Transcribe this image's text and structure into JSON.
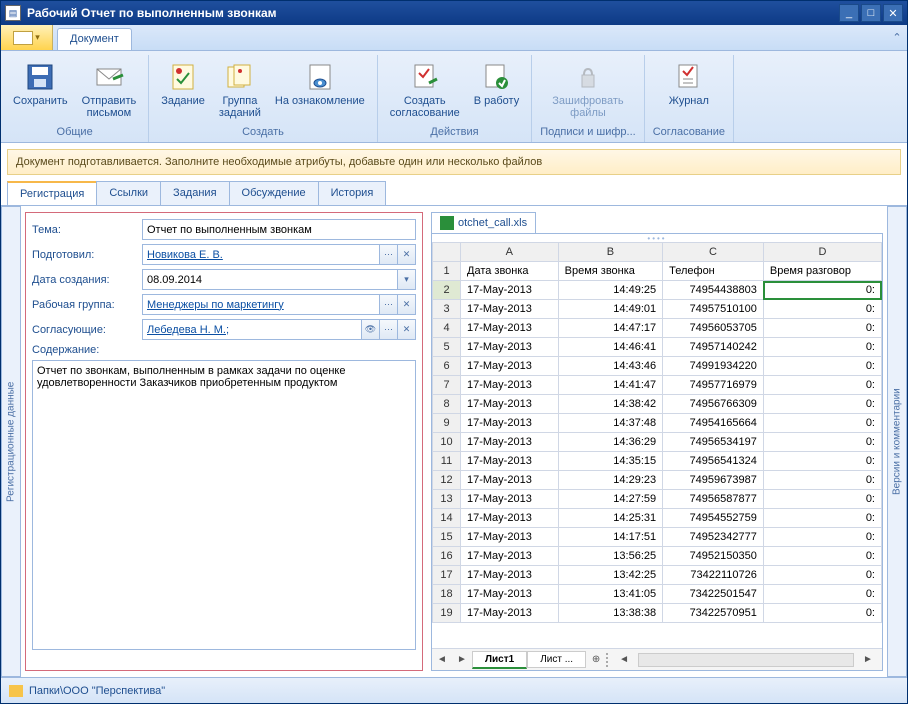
{
  "window_title": "Рабочий Отчет по выполненным звонкам",
  "ribbon": {
    "tab_document": "Документ",
    "groups": {
      "common": {
        "title": "Общие",
        "save": "Сохранить",
        "send": "Отправить\nписьмом"
      },
      "create": {
        "title": "Создать",
        "task": "Задание",
        "task_group": "Группа\nзаданий",
        "review": "На ознакомление"
      },
      "actions": {
        "title": "Действия",
        "approval": "Создать\nсогласование",
        "work": "В работу"
      },
      "sign": {
        "title": "Подписи и шифр...",
        "encrypt": "Зашифровать\nфайлы"
      },
      "approval": {
        "title": "Согласование",
        "journal": "Журнал"
      }
    }
  },
  "notice": "Документ подготавливается. Заполните необходимые атрибуты, добавьте один или несколько файлов",
  "tabs": {
    "registration": "Регистрация",
    "links": "Ссылки",
    "tasks": "Задания",
    "discussion": "Обсуждение",
    "history": "История"
  },
  "side": {
    "reg_data": "Регистрационные данные",
    "versions": "Версии и комментарии"
  },
  "form": {
    "subject_label": "Тема:",
    "subject": "Отчет по выполненным звонкам",
    "prepared_label": "Подготовил:",
    "prepared": "Новикова Е. В.",
    "date_label": "Дата создания:",
    "date": "08.09.2014",
    "group_label": "Рабочая группа:",
    "group": "Менеджеры по маркетингу",
    "approvers_label": "Согласующие:",
    "approvers": "Лебедева Н. М.;",
    "content_label": "Содержание:",
    "content": "Отчет по звонкам, выполненным в рамках задачи по оценке удовлетворенности Заказчиков приобретенным продуктом"
  },
  "file": {
    "name": "otchet_call.xls"
  },
  "sheet": {
    "cols": [
      "A",
      "B",
      "C",
      "D"
    ],
    "headers": [
      "Дата звонка",
      "Время звонка",
      "Телефон",
      "Время разговор"
    ],
    "rows": [
      [
        "17-May-2013",
        "14:49:25",
        "74954438803",
        "0:"
      ],
      [
        "17-May-2013",
        "14:49:01",
        "74957510100",
        "0:"
      ],
      [
        "17-May-2013",
        "14:47:17",
        "74956053705",
        "0:"
      ],
      [
        "17-May-2013",
        "14:46:41",
        "74957140242",
        "0:"
      ],
      [
        "17-May-2013",
        "14:43:46",
        "74991934220",
        "0:"
      ],
      [
        "17-May-2013",
        "14:41:47",
        "74957716979",
        "0:"
      ],
      [
        "17-May-2013",
        "14:38:42",
        "74956766309",
        "0:"
      ],
      [
        "17-May-2013",
        "14:37:48",
        "74954165664",
        "0:"
      ],
      [
        "17-May-2013",
        "14:36:29",
        "74956534197",
        "0:"
      ],
      [
        "17-May-2013",
        "14:35:15",
        "74956541324",
        "0:"
      ],
      [
        "17-May-2013",
        "14:29:23",
        "74959673987",
        "0:"
      ],
      [
        "17-May-2013",
        "14:27:59",
        "74956587877",
        "0:"
      ],
      [
        "17-May-2013",
        "14:25:31",
        "74954552759",
        "0:"
      ],
      [
        "17-May-2013",
        "14:17:51",
        "74952342777",
        "0:"
      ],
      [
        "17-May-2013",
        "13:56:25",
        "74952150350",
        "0:"
      ],
      [
        "17-May-2013",
        "13:42:25",
        "73422110726",
        "0:"
      ],
      [
        "17-May-2013",
        "13:41:05",
        "73422501547",
        "0:"
      ],
      [
        "17-May-2013",
        "13:38:38",
        "73422570951",
        "0:"
      ]
    ],
    "tabs": {
      "sheet1": "Лист1",
      "sheet_more": "Лист  ..."
    }
  },
  "footer": {
    "path": "Папки\\ООО \"Перспектива\""
  }
}
